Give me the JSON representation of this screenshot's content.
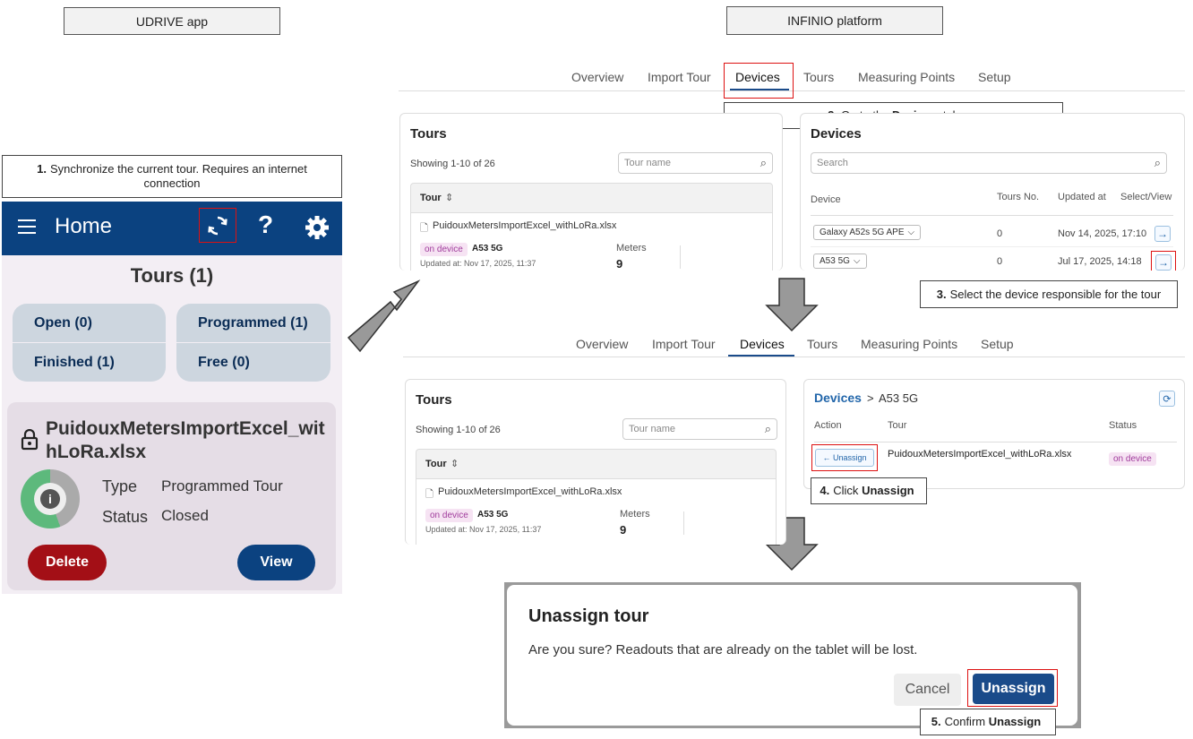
{
  "labels": {
    "udrive": "UDRIVE app",
    "infinio": "INFINIO platform"
  },
  "steps": {
    "s1_num": "1.",
    "s1_text": "Synchronize the current tour. Requires an internet connection",
    "s2_num": "2.",
    "s2_pre": "Go to the",
    "s2_bold": "Devices",
    "s2_post": "tab",
    "s3_num": "3.",
    "s3_text": "Select the device responsible for the tour",
    "s4_num": "4.",
    "s4_pre": "Click",
    "s4_bold": "Unassign",
    "s5_num": "5.",
    "s5_pre": "Confirm",
    "s5_bold": "Unassign"
  },
  "app": {
    "title": "Home",
    "tours_heading": "Tours (1)",
    "filters": {
      "open": "Open (0)",
      "programmed": "Programmed (1)",
      "finished": "Finished (1)",
      "free": "Free (0)"
    },
    "tour_name": "PuidouxMetersImportExcel_withLoRa.xlsx",
    "type_label": "Type",
    "type_value": "Programmed Tour",
    "status_label": "Status",
    "status_value": "Closed",
    "delete_label": "Delete",
    "view_label": "View",
    "info_glyph": "i"
  },
  "tabs": [
    "Overview",
    "Import Tour",
    "Devices",
    "Tours",
    "Measuring Points",
    "Setup"
  ],
  "tours_panel": {
    "title": "Tours",
    "showing": "Showing 1-10 of 26",
    "search_placeholder": "Tour name",
    "col_header": "Tour",
    "file": "PuidouxMetersImportExcel_withLoRa.xlsx",
    "badge": "on device",
    "device": "A53 5G",
    "updated": "Updated at: Nov 17, 2025, 11:37",
    "meters_label": "Meters",
    "meters_value": "9"
  },
  "devices_panel": {
    "title": "Devices",
    "search_placeholder": "Search",
    "cols": {
      "device": "Device",
      "tours": "Tours No.",
      "updated": "Updated at",
      "select": "Select/View"
    },
    "rows": [
      {
        "device": "Galaxy A52s 5G APE",
        "tours": "0",
        "updated": "Nov 14, 2025, 17:10"
      },
      {
        "device": "A53 5G",
        "tours": "0",
        "updated": "Jul 17, 2025, 14:18"
      }
    ]
  },
  "device_detail": {
    "breadcrumb_link": "Devices",
    "separator": ">",
    "device": "A53 5G",
    "cols": {
      "action": "Action",
      "tour": "Tour",
      "status": "Status"
    },
    "unassign_label": "← Unassign",
    "tour": "PuidouxMetersImportExcel_withLoRa.xlsx",
    "status": "on device"
  },
  "dialog": {
    "title": "Unassign tour",
    "message": "Are you sure? Readouts that are already on the tablet will be lost.",
    "cancel": "Cancel",
    "confirm": "Unassign"
  },
  "colors": {
    "app_header": "#0b4280",
    "delete_btn": "#a30f16",
    "view_btn": "#0b4280",
    "accent_blue": "#1a4b8a",
    "step_frame": "#d11111"
  }
}
